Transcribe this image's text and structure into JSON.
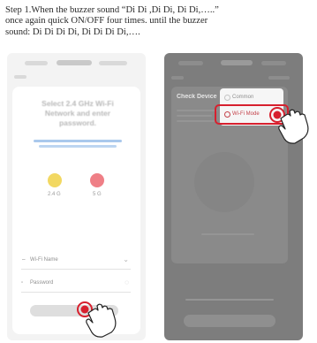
{
  "instruction": {
    "line1": "Step 1.When the buzzer sound “Di Di ,Di Di, Di Di,…..”",
    "line2": "once again quick ON/OFF four times. until the buzzer",
    "line3": "sound: Di Di Di Di, Di Di Di Di,…."
  },
  "phone1": {
    "title": "Select 2.4 GHz Wi-Fi Network and enter password.",
    "dot1_label": "2.4 G",
    "dot2_label": "5 G",
    "wifi_label": "Wi-Fi Name",
    "password_label": "Password"
  },
  "phone2": {
    "heading": "Check Device",
    "option1": "Common",
    "option2": "Wi-Fi Mode"
  },
  "colors": {
    "highlight": "#d7202e",
    "dot_yellow": "#f2d862",
    "dot_red": "#ef7f86"
  }
}
